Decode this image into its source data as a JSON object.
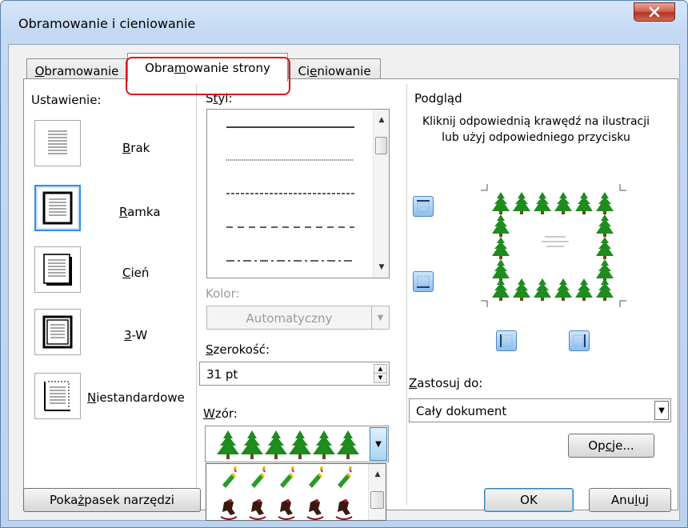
{
  "window": {
    "title": "Obramowanie i cieniowanie"
  },
  "tabs": [
    {
      "prefix": "",
      "key": "O",
      "suffix": "bramowanie"
    },
    {
      "prefix": "Obra",
      "key": "m",
      "suffix": "owanie strony"
    },
    {
      "prefix": "Ci",
      "key": "e",
      "suffix": "niowanie"
    }
  ],
  "settings": {
    "heading": "Ustawienie:",
    "items": [
      {
        "prefix": "",
        "key": "B",
        "suffix": "rak"
      },
      {
        "prefix": "",
        "key": "R",
        "suffix": "amka"
      },
      {
        "prefix": "",
        "key": "C",
        "suffix": "ień"
      },
      {
        "prefix": "",
        "key": "3",
        "suffix": "-W"
      },
      {
        "prefix": "",
        "key": "N",
        "suffix": "iestandardowe"
      }
    ]
  },
  "style": {
    "prefix": "S",
    "key": "t",
    "suffix": "yl:"
  },
  "color": {
    "label": "Kolor:",
    "value": "Automatyczny"
  },
  "width": {
    "prefix": "",
    "key": "S",
    "suffix": "zerokość:",
    "value": "31 pt"
  },
  "pattern": {
    "prefix": "",
    "key": "W",
    "suffix": "zór:"
  },
  "preview": {
    "heading": "Podgląd",
    "hint_line1": "Kliknij odpowiednią krawędź na ilustracji",
    "hint_line2": "lub użyj odpowiedniego przycisku"
  },
  "apply_to": {
    "prefix": "",
    "key": "Z",
    "suffix": "astosuj do:",
    "value": "Cały dokument"
  },
  "buttons": {
    "options": {
      "prefix": "Op",
      "key": "c",
      "suffix": "je..."
    },
    "toolbar": {
      "prefix": "Poka",
      "key": "ż",
      "suffix": " pasek narzędzi"
    },
    "ok": "OK",
    "cancel": {
      "prefix": "Anu",
      "key": "l",
      "suffix": "uj"
    }
  },
  "colors": {
    "accent": "#2f8ee8",
    "highlight": "#e0141c",
    "tree": "#1e8c1e",
    "disabled_text": "#9a9a9a"
  },
  "icons": {
    "close": "close-x-icon",
    "tree": "christmas-tree-icon",
    "pattern_items": [
      "candle-icon",
      "rocking-horse-icon"
    ]
  }
}
